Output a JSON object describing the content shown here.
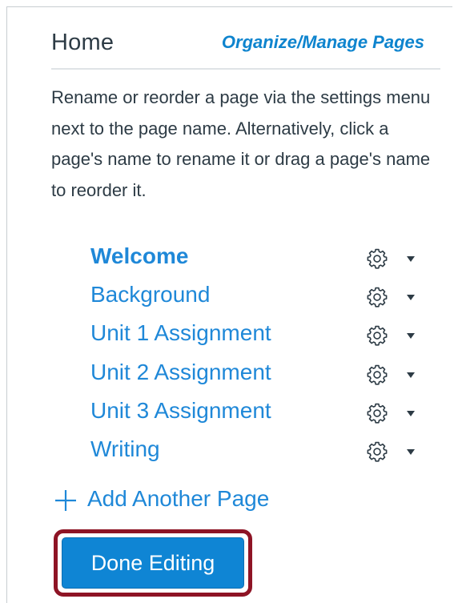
{
  "header": {
    "title": "Home",
    "organize_link": "Organize/Manage Pages"
  },
  "instructions": "Rename or reorder a page via the settings menu next to the page name. Alternatively, click a page's name to rename it or drag a page's name to reorder it.",
  "pages": [
    {
      "name": "Welcome",
      "active": true
    },
    {
      "name": "Background",
      "active": false
    },
    {
      "name": "Unit 1 Assignment",
      "active": false
    },
    {
      "name": "Unit 2 Assignment",
      "active": false
    },
    {
      "name": "Unit 3 Assignment",
      "active": false
    },
    {
      "name": "Writing",
      "active": false
    }
  ],
  "icons": {
    "settings": "gear-icon",
    "menu": "caret-down-icon",
    "add": "plus-icon"
  },
  "add_page_label": "Add Another Page",
  "done_button_label": "Done Editing",
  "colors": {
    "link": "#1f88d8",
    "text": "#2d3b45",
    "primary_button": "#0f85d4",
    "highlight_border": "#8e1425"
  }
}
